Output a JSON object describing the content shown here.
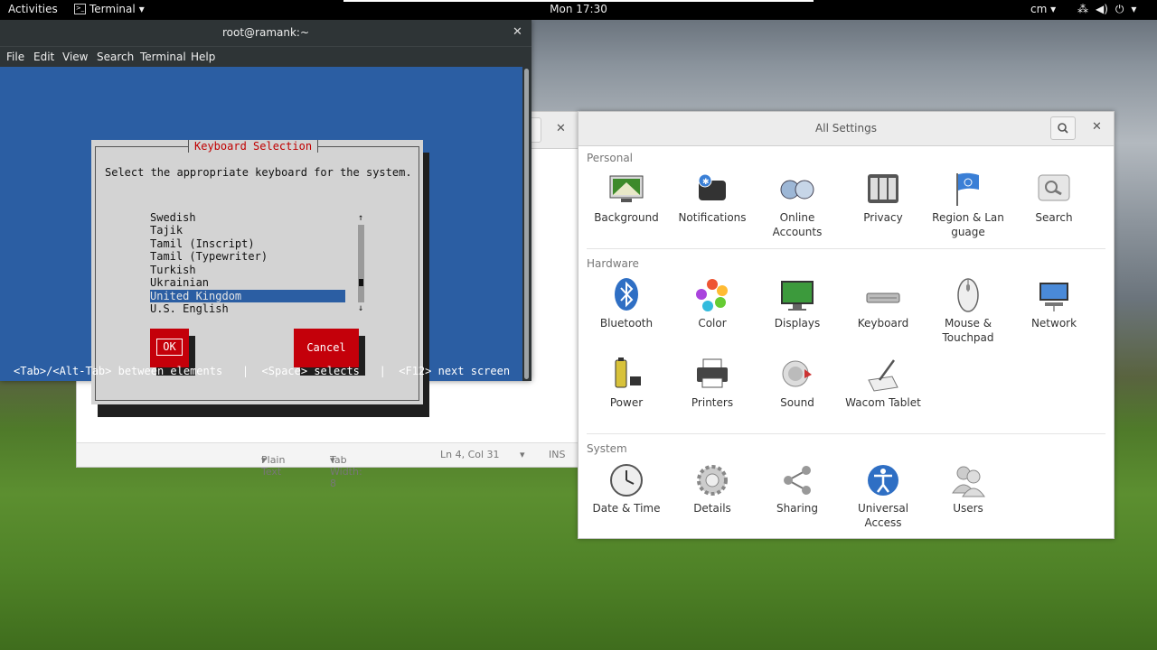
{
  "topbar": {
    "activities": "Activities",
    "app_menu": "Terminal",
    "clock": "Mon 17:30",
    "input_source": "cm"
  },
  "terminal": {
    "title": "root@ramank:~",
    "menu": [
      "File",
      "Edit",
      "View",
      "Search",
      "Terminal",
      "Help"
    ],
    "dialog": {
      "title": "Keyboard Selection",
      "prompt": "Select the appropriate keyboard for the system.",
      "items": [
        "Swedish",
        "Tajik",
        "Tamil (Inscript)",
        "Tamil (Typewriter)",
        "Turkish",
        "Ukrainian",
        "United Kingdom",
        "U.S. English"
      ],
      "selected_index": 6,
      "ok_label": "OK",
      "cancel_label": "Cancel"
    },
    "hint": "<Tab>/<Alt-Tab> between elements   |  <Space> selects   |  <F12> next screen"
  },
  "gedit": {
    "status": {
      "language": "Plain Text",
      "tab_width": "Tab Width: 8",
      "position": "Ln 4, Col 31",
      "mode": "INS"
    }
  },
  "settings": {
    "title": "All Settings",
    "sections": [
      {
        "name": "Personal",
        "items": [
          {
            "label": "Background",
            "icon": "background-icon"
          },
          {
            "label": "Notifications",
            "icon": "notifications-icon"
          },
          {
            "label": "Online\nAccounts",
            "icon": "online-accounts-icon"
          },
          {
            "label": "Privacy",
            "icon": "privacy-icon"
          },
          {
            "label": "Region & Lan\nguage",
            "icon": "region-language-icon"
          },
          {
            "label": "Search",
            "icon": "search-icon"
          }
        ]
      },
      {
        "name": "Hardware",
        "items": [
          {
            "label": "Bluetooth",
            "icon": "bluetooth-icon"
          },
          {
            "label": "Color",
            "icon": "color-icon"
          },
          {
            "label": "Displays",
            "icon": "displays-icon"
          },
          {
            "label": "Keyboard",
            "icon": "keyboard-icon"
          },
          {
            "label": "Mouse &\nTouchpad",
            "icon": "mouse-icon"
          },
          {
            "label": "Network",
            "icon": "network-icon"
          },
          {
            "label": "Power",
            "icon": "power-icon"
          },
          {
            "label": "Printers",
            "icon": "printer-icon"
          },
          {
            "label": "Sound",
            "icon": "sound-icon"
          },
          {
            "label": "Wacom Tablet",
            "icon": "wacom-tablet-icon"
          }
        ]
      },
      {
        "name": "System",
        "items": [
          {
            "label": "Date & Time",
            "icon": "clock-icon"
          },
          {
            "label": "Details",
            "icon": "gear-icon"
          },
          {
            "label": "Sharing",
            "icon": "sharing-icon"
          },
          {
            "label": "Universal\nAccess",
            "icon": "accessibility-icon"
          },
          {
            "label": "Users",
            "icon": "users-icon"
          }
        ]
      }
    ]
  },
  "colors": {
    "terminal_blue": "#2b5ea3",
    "dialog_red": "#c4000a",
    "dialog_gray": "#d3d3d3"
  }
}
